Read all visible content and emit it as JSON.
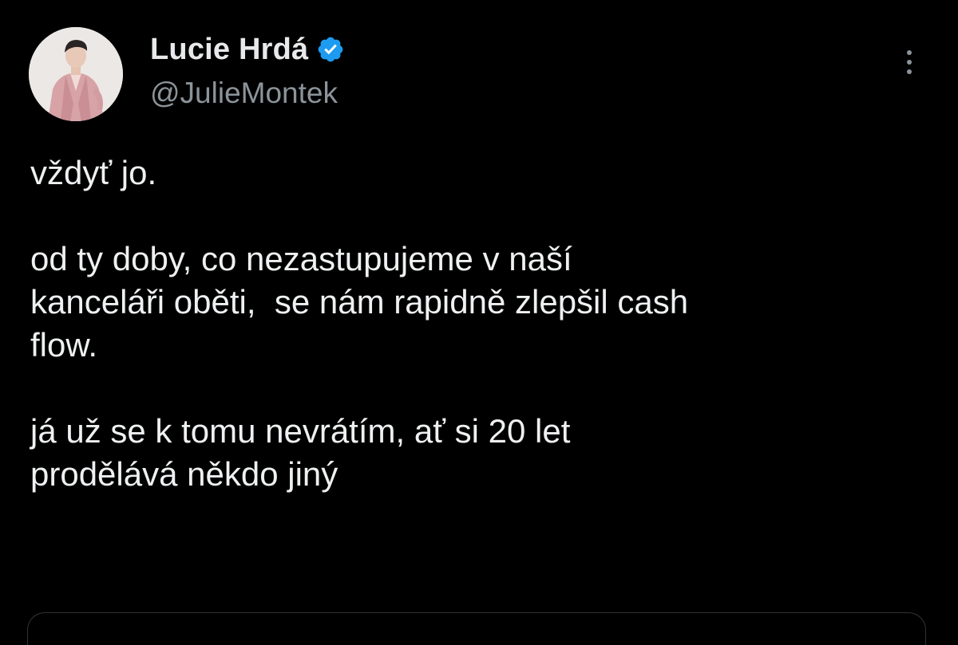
{
  "author": {
    "display_name": "Lucie Hrdá",
    "handle": "@JulieMontek",
    "verified": true,
    "verified_icon": "verified-badge-icon",
    "avatar_icon": "profile-photo"
  },
  "tweet": {
    "paragraphs": [
      "vždyť jo.",
      "od ty doby, co nezastupujeme v naší\nkanceláři oběti,  se nám rapidně zlepšil cash\nflow.",
      "já už se k tomu nevrátím, ať si 20 let\nprodělává někdo jiný"
    ]
  },
  "menu": {
    "icon": "more-options-icon"
  },
  "colors": {
    "background": "#000000",
    "text_primary": "#e7e9ea",
    "text_secondary": "#8b949a",
    "verified_blue": "#1d9bf0",
    "border": "#2f3336"
  }
}
